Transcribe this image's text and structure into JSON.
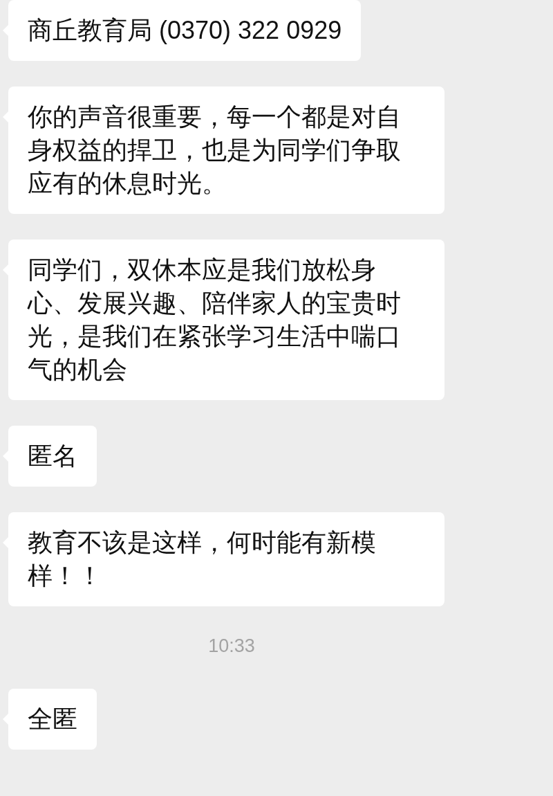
{
  "messages": [
    {
      "kind": "bubble",
      "text": "商丘教育局 (0370) 322 0929"
    },
    {
      "kind": "bubble",
      "text": "你的声音很重要，每一个都是对自身权益的捍卫，也是为同学们争取应有的休息时光。"
    },
    {
      "kind": "bubble",
      "text": "同学们，双休本应是我们放松身心、发展兴趣、陪伴家人的宝贵时光，是我们在紧张学习生活中喘口气的机会"
    },
    {
      "kind": "bubble",
      "text": "匿名"
    },
    {
      "kind": "bubble",
      "text": "教育不该是这样，何时能有新模样！！"
    },
    {
      "kind": "time",
      "text": "10:33"
    },
    {
      "kind": "bubble",
      "text": "全匿"
    }
  ]
}
